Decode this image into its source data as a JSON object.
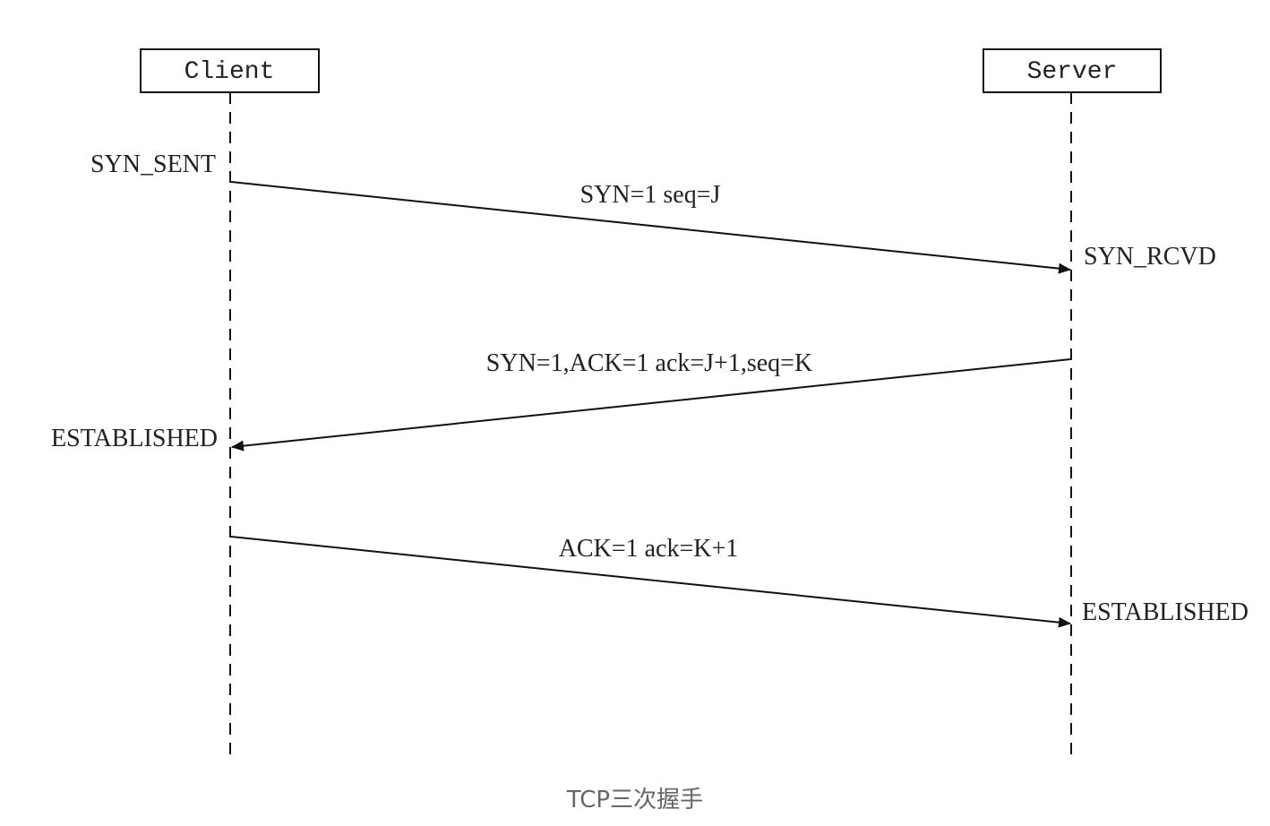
{
  "participants": {
    "client": "Client",
    "server": "Server"
  },
  "states": {
    "client_syn_sent": "SYN_SENT",
    "server_syn_rcvd": "SYN_RCVD",
    "client_established": "ESTABLISHED",
    "server_established": "ESTABLISHED"
  },
  "messages": [
    {
      "label": "SYN=1 seq=J",
      "from": "client",
      "to": "server"
    },
    {
      "label": "SYN=1,ACK=1 ack=J+1,seq=K",
      "from": "server",
      "to": "client"
    },
    {
      "label": "ACK=1 ack=K+1",
      "from": "client",
      "to": "server"
    }
  ],
  "caption": "TCP三次握手",
  "colors": {
    "line": "#111111",
    "text": "#222222",
    "caption": "#666666"
  }
}
